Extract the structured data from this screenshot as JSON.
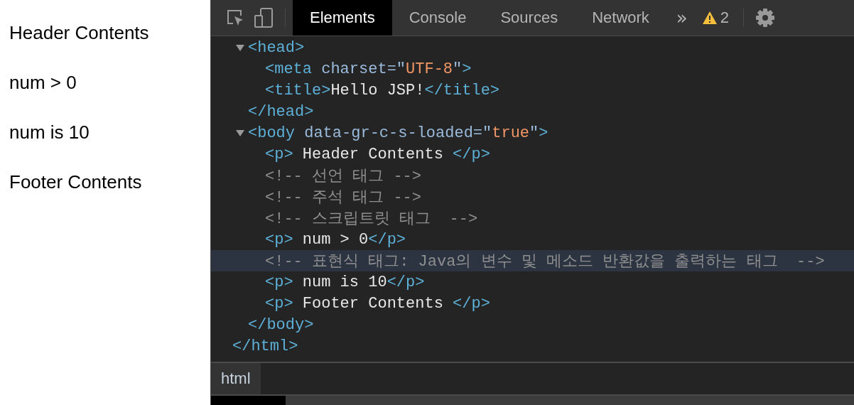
{
  "page": {
    "paragraphs": [
      "Header Contents",
      "num > 0",
      "num is 10",
      "Footer Contents"
    ]
  },
  "devtools": {
    "tabs": [
      {
        "label": "Elements",
        "selected": true
      },
      {
        "label": "Console",
        "selected": false
      },
      {
        "label": "Sources",
        "selected": false
      },
      {
        "label": "Network",
        "selected": false
      }
    ],
    "overflow": "»",
    "warnings": "2",
    "tree": [
      {
        "close": [
          {
            "kind": "tag",
            "text": "</html>"
          }
        ],
        "highlighted": false,
        "children": [
          {
            "open": [
              {
                "kind": "tag",
                "text": "<head>"
              }
            ],
            "expanded": true,
            "highlighted": false,
            "children": [
              {
                "open": [
                  {
                    "kind": "tag",
                    "text": "<meta"
                  },
                  {
                    "kind": "attr",
                    "text": " charset=\""
                  },
                  {
                    "kind": "val",
                    "text": "UTF-8"
                  },
                  {
                    "kind": "attr",
                    "text": "\""
                  },
                  {
                    "kind": "tag",
                    "text": ">"
                  }
                ],
                "highlighted": false
              },
              {
                "open": [
                  {
                    "kind": "tag",
                    "text": "<title>"
                  },
                  {
                    "kind": "text",
                    "text": "Hello JSP!"
                  },
                  {
                    "kind": "tag",
                    "text": "</title>"
                  }
                ],
                "highlighted": false
              }
            ],
            "close": [
              {
                "kind": "tag",
                "text": "</head>"
              }
            ]
          },
          {
            "open": [
              {
                "kind": "tag",
                "text": "<body"
              },
              {
                "kind": "attr",
                "text": " data-gr-c-s-loaded=\""
              },
              {
                "kind": "val",
                "text": "true"
              },
              {
                "kind": "attr",
                "text": "\""
              },
              {
                "kind": "tag",
                "text": ">"
              }
            ],
            "expanded": true,
            "highlighted": false,
            "children": [
              {
                "open": [
                  {
                    "kind": "tag",
                    "text": "<p>"
                  },
                  {
                    "kind": "text",
                    "text": " Header Contents "
                  },
                  {
                    "kind": "tag",
                    "text": "</p>"
                  }
                ],
                "highlighted": false
              },
              {
                "open": [
                  {
                    "kind": "comment",
                    "text": "<!-- 선언 태그 -->"
                  }
                ],
                "highlighted": false
              },
              {
                "open": [
                  {
                    "kind": "comment",
                    "text": "<!-- 주석 태그 -->"
                  }
                ],
                "highlighted": false
              },
              {
                "open": [
                  {
                    "kind": "comment",
                    "text": "<!-- 스크립트릿 태그  -->"
                  }
                ],
                "highlighted": false
              },
              {
                "open": [
                  {
                    "kind": "tag",
                    "text": "<p>"
                  },
                  {
                    "kind": "text",
                    "text": " num > 0"
                  },
                  {
                    "kind": "tag",
                    "text": "</p>"
                  }
                ],
                "highlighted": false
              },
              {
                "open": [
                  {
                    "kind": "comment",
                    "text": "<!-- 표현식 태그: Java의 변수 및 메소드 반환값을 출력하는 태그  -->"
                  }
                ],
                "highlighted": true
              },
              {
                "open": [
                  {
                    "kind": "tag",
                    "text": "<p>"
                  },
                  {
                    "kind": "text",
                    "text": " num is 10"
                  },
                  {
                    "kind": "tag",
                    "text": "</p>"
                  }
                ],
                "highlighted": false
              },
              {
                "open": [
                  {
                    "kind": "tag",
                    "text": "<p>"
                  },
                  {
                    "kind": "text",
                    "text": " Footer Contents "
                  },
                  {
                    "kind": "tag",
                    "text": "</p>"
                  }
                ],
                "highlighted": false
              }
            ],
            "close": [
              {
                "kind": "tag",
                "text": "</body>"
              }
            ]
          }
        ]
      }
    ],
    "breadcrumbs": [
      {
        "label": "html",
        "selected": true
      }
    ]
  }
}
